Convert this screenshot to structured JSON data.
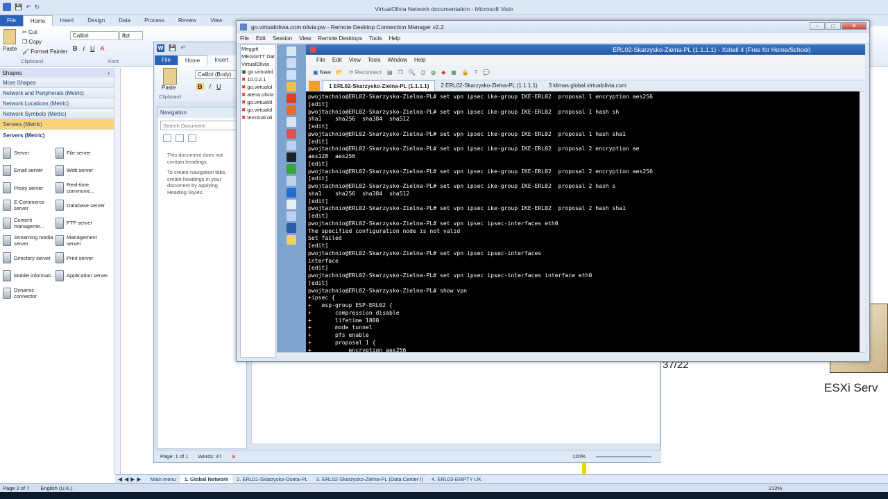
{
  "visio": {
    "title": "VirtualOlivia Network documentation  -  Microsoft Visio",
    "tabs": [
      "File",
      "Home",
      "Insert",
      "Design",
      "Data",
      "Process",
      "Review",
      "View"
    ],
    "ribbon": {
      "paste": "Paste",
      "cut": "Cut",
      "copy": "Copy",
      "format_painter": "Format Painter",
      "clipboard": "Clipboard",
      "font_name": "Calibri",
      "font_size": "8pt",
      "font": "Font"
    },
    "shapes_header": "Shapes",
    "stencils": [
      "More Shapes",
      "Network and Peripherals (Metric)",
      "Network Locations (Metric)",
      "Network Symbols (Metric)",
      "Servers (Metric)"
    ],
    "stencil_title": "Servers (Metric)",
    "shapes": [
      {
        "label": "Server"
      },
      {
        "label": "File server"
      },
      {
        "label": "Email server"
      },
      {
        "label": "Web server"
      },
      {
        "label": "Proxy server"
      },
      {
        "label": "Real-time communic..."
      },
      {
        "label": "E-Commerce server"
      },
      {
        "label": "Database server"
      },
      {
        "label": "Content manageme..."
      },
      {
        "label": "FTP server"
      },
      {
        "label": "Streaming media server"
      },
      {
        "label": "Management server"
      },
      {
        "label": "Directory server"
      },
      {
        "label": "Print server"
      },
      {
        "label": "Mobile informati..."
      },
      {
        "label": "Application server"
      },
      {
        "label": "Dynamic connector"
      }
    ],
    "page_tabs": [
      "Main menu",
      "1. Global Network",
      "2. ERL01-Skarzysko-Oseta-PL",
      "3. ERL02-Skarzysko-Zielna-PL (Data Center I)",
      "4. ERL03-EMPTY UK"
    ],
    "status": {
      "page": "Page 2 of 7",
      "language": "English (U.K.)",
      "zoom": "212%"
    },
    "canvas_labels": {
      "ip": "37/22",
      "esxi": "ESXi Serv"
    }
  },
  "word": {
    "tabs": [
      "File",
      "Home",
      "Insert"
    ],
    "paste": "Paste",
    "font": "Calibri (Body)",
    "clipboard": "Clipboard",
    "nav_title": "Navigation",
    "search_placeholder": "Search Document",
    "nav_msg1": "This document does not contain headings.",
    "nav_msg2": "To create navigation tabs, create headings in your document by applying Heading Styles.",
    "status": {
      "page": "Page: 1 of 1",
      "words": "Words: 47",
      "zoom": "120%"
    }
  },
  "rdcm": {
    "title": "go.virtualolivia.com:olivia:pw - Remote Desktop Connection Manager v2.2",
    "menu": [
      "File",
      "Edit",
      "Session",
      "View",
      "Remote Desktops",
      "Tools",
      "Help"
    ],
    "tree": [
      {
        "label": "Meggitt",
        "status": "none"
      },
      {
        "label": "MEGGITT Dat",
        "status": "none"
      },
      {
        "label": "VirtualOlivia",
        "status": "none"
      },
      {
        "label": "go.virtualol",
        "status": "ok"
      },
      {
        "label": "10.0.2.1",
        "status": "error"
      },
      {
        "label": "go.virtualol",
        "status": "error"
      },
      {
        "label": "atena.olivia",
        "status": "error"
      },
      {
        "label": "go.virtualol",
        "status": "error"
      },
      {
        "label": "go.virtualol",
        "status": "error"
      },
      {
        "label": "terminal.oli",
        "status": "error"
      }
    ]
  },
  "xshell": {
    "title": "ERL02-Skarzysko-Zielna-PL (1.1.1.1) - Xshell 4 (Free for Home/School)",
    "menu": [
      "File",
      "Edit",
      "View",
      "Tools",
      "Window",
      "Help"
    ],
    "toolbar": {
      "new": "New",
      "reconnect": "Reconnect"
    },
    "tabs": [
      "1 ERL02-Skarzysko-Zielna-PL (1.1.1.1)",
      "2 ERL02-Skarzysko-Zielna-PL (1.1.1.1)",
      "3 klimas.global.virtualolivia.com"
    ],
    "terminal_lines": [
      "pwojtachnio@ERL02-Skarzysko-Zielna-PL# set vpn ipsec ike-group IKE-ERL02  proposal 1 encryption aes256",
      "[edit]",
      "pwojtachnio@ERL02-Skarzysko-Zielna-PL# set vpn ipsec ike-group IKE-ERL02  proposal 1 hash sh",
      "sha1    sha256  sha384  sha512",
      "[edit]",
      "pwojtachnio@ERL02-Skarzysko-Zielna-PL# set vpn ipsec ike-group IKE-ERL02  proposal 1 hash sha1",
      "[edit]",
      "pwojtachnio@ERL02-Skarzysko-Zielna-PL# set vpn ipsec ike-group IKE-ERL02  proposal 2 encryption ae",
      "aes128  aes256",
      "[edit]",
      "pwojtachnio@ERL02-Skarzysko-Zielna-PL# set vpn ipsec ike-group IKE-ERL02  proposal 2 encryption aes256",
      "[edit]",
      "pwojtachnio@ERL02-Skarzysko-Zielna-PL# set vpn ipsec ike-group IKE-ERL02  proposal 2 hash s",
      "sha1    sha256  sha384  sha512",
      "[edit]",
      "pwojtachnio@ERL02-Skarzysko-Zielna-PL# set vpn ipsec ike-group IKE-ERL02  proposal 2 hash sha1",
      "[edit]",
      "pwojtachnio@ERL02-Skarzysko-Zielna-PL# set vpn ipsec ipsec-interfaces eth0",
      "The specified configuration node is not valid",
      "Set failed",
      "[edit]",
      "pwojtachnio@ERL02-Skarzysko-Zielna-PL# set vpn ipsec ipsec-interfaces",
      "interface",
      "[edit]",
      "pwojtachnio@ERL02-Skarzysko-Zielna-PL# set vpn ipsec ipsec-interfaces interface eth0",
      "[edit]",
      "pwojtachnio@ERL02-Skarzysko-Zielna-PL# show vpn",
      "+ipsec {",
      "+   esp-group ESP-ERL02 {",
      "+       compression disable",
      "+       lifetime 1800",
      "+       mode tunnel",
      "+       pfs enable",
      "+       proposal 1 {",
      "+           encryption aes256"
    ]
  },
  "colors": {
    "xshell_title": "#2f66b3",
    "terminal_bg": "#000000",
    "strip": "#7ea3cf",
    "visio_active_stencil": "#f8d37a"
  }
}
